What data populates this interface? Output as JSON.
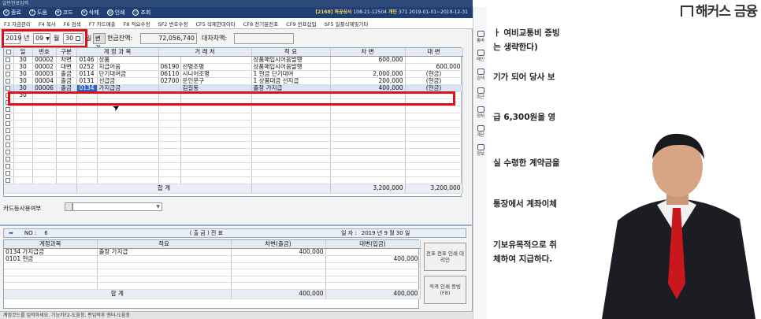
{
  "window": {
    "title": "일반전표입력"
  },
  "toolbar1": {
    "buttons": [
      {
        "label": "종료",
        "icon": "close-icon"
      },
      {
        "label": "도움",
        "icon": "help-icon"
      },
      {
        "label": "코드",
        "icon": "code-icon"
      },
      {
        "label": "삭제",
        "icon": "delete-icon"
      },
      {
        "label": "인쇄",
        "icon": "print-icon"
      },
      {
        "label": "조회",
        "icon": "search-icon"
      }
    ],
    "company_code": "[2168]",
    "company_name": "목공상사",
    "biz_no": "108-21-12504",
    "type": "개인",
    "period": "371  2019-01-01~2019-12-31"
  },
  "toolbar2": {
    "buttons": [
      "F3 자금관리",
      "F4 복사",
      "F6 검색",
      "F7 카드매출",
      "F8 적요수정",
      "SF2 번호수정",
      "CF5 삭제한데이타",
      "CF8 전기분전표",
      "CF9 전표삽입",
      "SF5 일괄삭제및기타"
    ]
  },
  "filter": {
    "year": "2019",
    "year_label": "년",
    "month": "09",
    "month_label": "월",
    "day": "30",
    "day_label": "일",
    "change_button": "변경",
    "cash_label": "현금잔액:",
    "cash_value": "72,056,740",
    "diff_label": "대차차액:",
    "diff_value": ""
  },
  "grid": {
    "headers": [
      "일",
      "번호",
      "구분",
      "계 정 과 목",
      "",
      "거 래 처",
      "",
      "적 요",
      "차 변",
      "대 변"
    ],
    "rows": [
      {
        "day": "30",
        "no": "00002",
        "type": "차변",
        "acct_code": "0146",
        "acct": "상품",
        "cust_code": "",
        "cust": "",
        "memo": "상품매입시어음발행",
        "debit": "600,000",
        "credit": ""
      },
      {
        "day": "30",
        "no": "00002",
        "type": "대변",
        "acct_code": "0252",
        "acct": "지급어음",
        "cust_code": "06190",
        "cust": "선명조명",
        "memo": "상품매입시어음발행",
        "debit": "",
        "credit": "600,000"
      },
      {
        "day": "30",
        "no": "00003",
        "type": "출금",
        "acct_code": "0114",
        "acct": "단기대여금",
        "cust_code": "06110",
        "cust": "시니어조명",
        "memo": "1 현금 단기대여",
        "debit": "2,000,000",
        "credit": "(현금)"
      },
      {
        "day": "30",
        "no": "00004",
        "type": "출금",
        "acct_code": "0131",
        "acct": "선급금",
        "cust_code": "02700",
        "cust": "운인문구",
        "memo": "1 상품대금 선지급",
        "debit": "200,000",
        "credit": "(현금)"
      },
      {
        "day": "30",
        "no": "00006",
        "type": "출금",
        "acct_code": "0134",
        "acct": "가지급금",
        "cust_code": "",
        "cust": "김길동",
        "memo": "출장 가지급",
        "debit": "400,000",
        "credit": "(현금)"
      },
      {
        "day": "30",
        "no": "",
        "type": "",
        "acct_code": "",
        "acct": "",
        "cust_code": "",
        "cust": "",
        "memo": "",
        "debit": "",
        "credit": ""
      }
    ],
    "total_label": "합          계",
    "total_debit": "3,200,000",
    "total_credit": "3,200,000"
  },
  "card": {
    "label": "카드등사용여부"
  },
  "voucher": {
    "no_label": "NO :",
    "no": "6",
    "title": "( 출 금 )   전   표",
    "date_label": "일 자 :",
    "date": "2019 년  9 월 30 일",
    "headers": [
      "계정과목",
      "적요",
      "차변(출금)",
      "대변(입금)"
    ],
    "rows": [
      {
        "acct": "0134 가지급금",
        "memo": "출장 가지급",
        "debit": "400,000",
        "credit": ""
      },
      {
        "acct": "0101 현금",
        "memo": "",
        "debit": "",
        "credit": "400,000"
      }
    ],
    "total_label": "합          계",
    "total_debit": "400,000",
    "total_credit": "400,000",
    "btn_a": "전표 전표 인쇄 대리인",
    "btn_b": "적격 인쇄 증빙 (F8)"
  },
  "statusbar": {
    "text": "계정코드를 입력하세요. 기능키F2-도움창,  편입력후 엔터-도움창"
  },
  "sidepanel": {
    "items": [
      "통바",
      "매인",
      "검색",
      "최근",
      "정처",
      "계산",
      "정보"
    ]
  },
  "doc": {
    "brand": "해커스 금융",
    "lines": [
      "ㅏ 여비교통비 증빙",
      "는 생략한다)",
      "기가 되어 당사 보",
      "급 6,300원을 영",
      "실 수령한 계약금을",
      "통장에서 계좌이체",
      "기보유목적으로 취",
      "체하여 지급하다."
    ]
  }
}
